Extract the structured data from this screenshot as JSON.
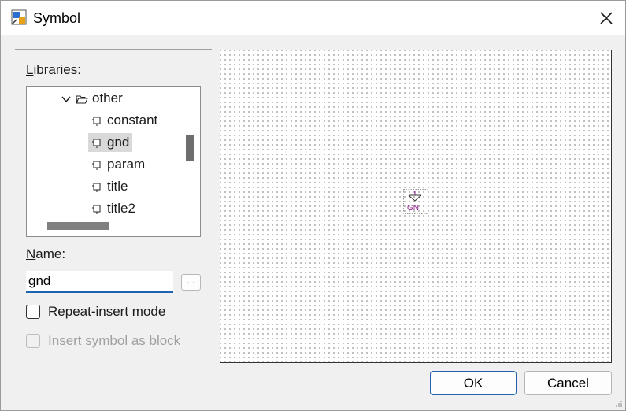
{
  "window": {
    "title": "Symbol",
    "close_icon": "close-icon"
  },
  "libraries": {
    "label_first": "L",
    "label_rest": "ibraries:",
    "folder": "other",
    "items": [
      "constant",
      "gnd",
      "param",
      "title",
      "title2"
    ],
    "selected": "gnd"
  },
  "name": {
    "label_first": "N",
    "label_rest": "ame:",
    "value": "gnd",
    "browse_label": "..."
  },
  "options": {
    "repeat_first": "R",
    "repeat_rest": "epeat-insert mode",
    "repeat_checked": false,
    "block_first": "I",
    "block_rest": "nsert symbol as block",
    "block_checked": false,
    "block_enabled": false
  },
  "preview": {
    "symbol_text": "GNI",
    "symbol_color": "#8b1a8b"
  },
  "buttons": {
    "ok": "OK",
    "cancel": "Cancel"
  }
}
